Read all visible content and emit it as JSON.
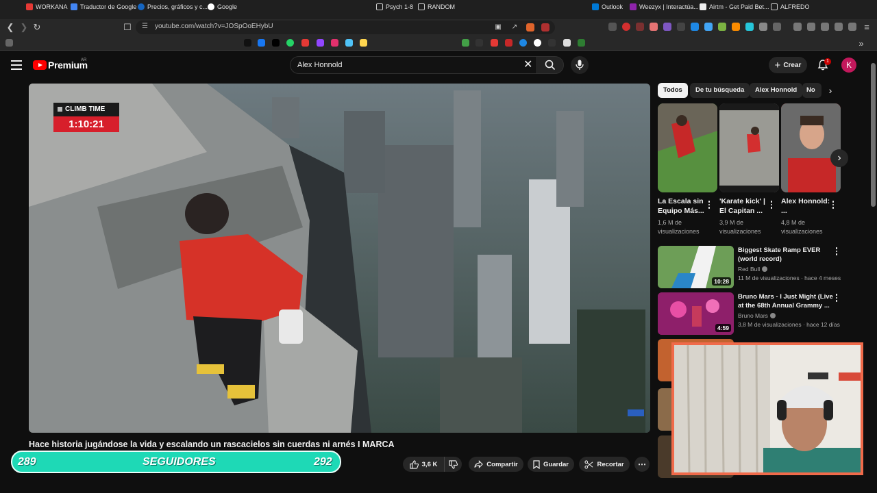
{
  "browser": {
    "url": "youtube.com/watch?v=JOSpOoEHybU",
    "bookmarks": [
      "WORKANA",
      "Traductor de Google",
      "Precios, gráficos y c...",
      "Google",
      "Psych 1-8",
      "RANDOM",
      "Outlook",
      "Weezyx | Interactúa...",
      "Airtm - Get Paid Bet...",
      "ALFREDO"
    ]
  },
  "header": {
    "logo_text": "Premium",
    "logo_region": "AR",
    "search_value": "Alex Honnold",
    "create_label": "Crear",
    "notifications_count": "1",
    "avatar_initial": "K"
  },
  "video": {
    "overlay_label": "CLIMB TIME",
    "overlay_time": "1:10:21",
    "title": "Hace historia jugándose la vida y escalando un rascacielos sin cuerdas ni arnés I MARCA",
    "actions": {
      "likes": "3,6 K",
      "share": "Compartir",
      "save": "Guardar",
      "clip": "Recortar"
    }
  },
  "followers_overlay": {
    "left_count": "289",
    "label": "SEGUIDORES",
    "right_count": "292"
  },
  "chips": [
    "Todos",
    "De tu búsqueda",
    "Alex Honnold",
    "No"
  ],
  "shorts": [
    {
      "title": "La Escala sin Equipo Más...",
      "views": "1,6 M de visualizaciones"
    },
    {
      "title": "'Karate kick' | El Capitan ...",
      "views": "3,9 M de visualizaciones"
    },
    {
      "title": "Alex Honnold: ...",
      "views": "4,8 M de visualizaciones"
    }
  ],
  "related": [
    {
      "title": "Biggest Skate Ramp EVER (world record)",
      "channel": "Red Bull",
      "meta": "11 M de visualizaciones · hace 4 meses",
      "duration": "10:28"
    },
    {
      "title": "Bruno Mars - I Just Might (Live at the 68th Annual Grammy ...",
      "channel": "Bruno Mars",
      "meta": "3,8 M de visualizaciones · hace 12 días",
      "duration": "4:59"
    }
  ],
  "colors": {
    "accent": "#ff0000",
    "followers": "#1ed9b6",
    "webcam_border": "#f06a4a"
  }
}
